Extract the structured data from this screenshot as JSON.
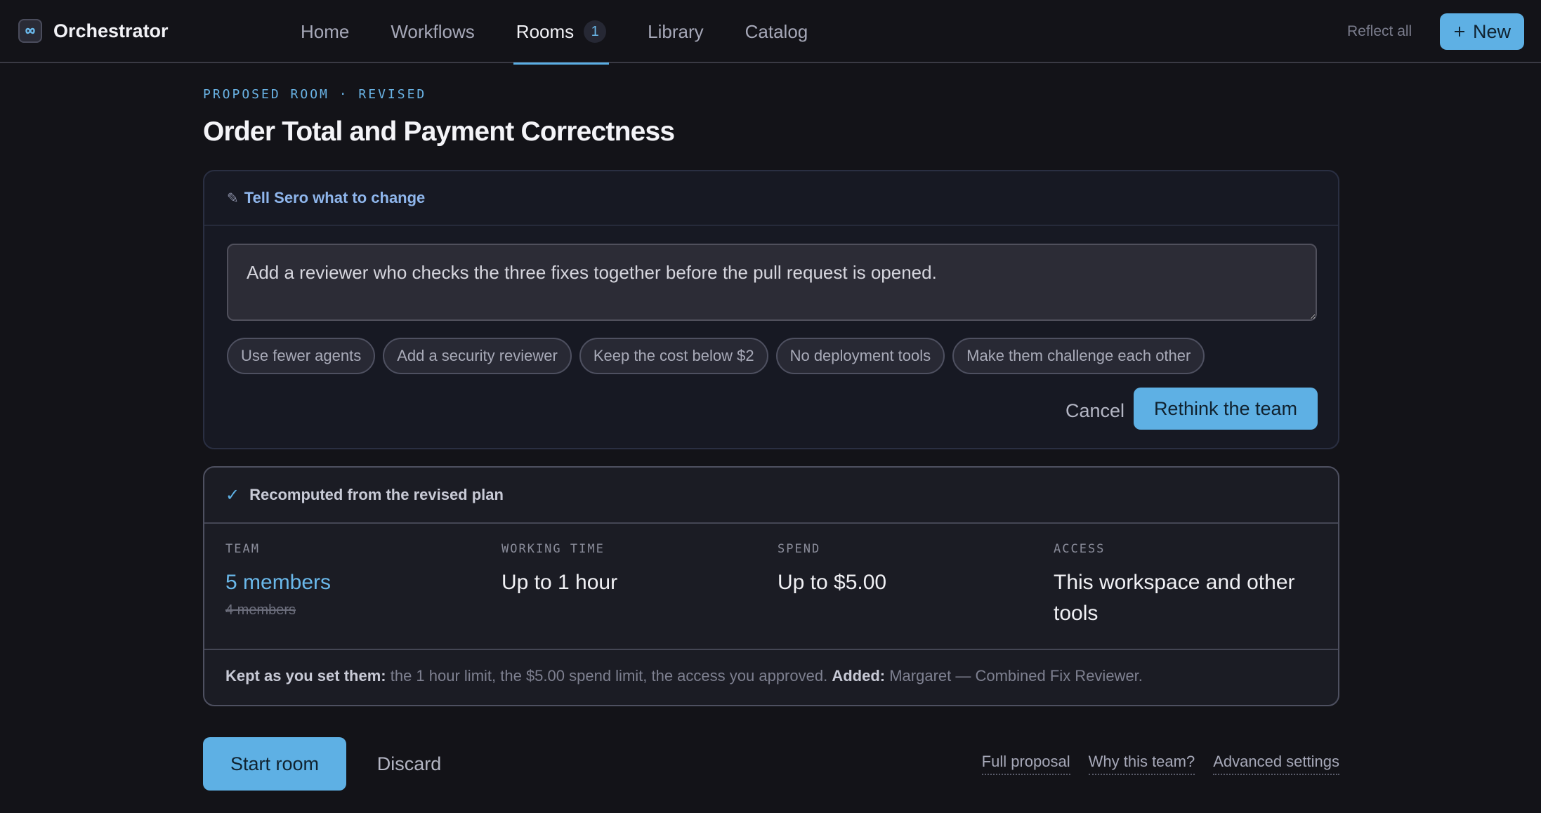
{
  "app": {
    "name": "Orchestrator",
    "logo_icon": "infinity-logo-icon"
  },
  "nav": {
    "items": [
      {
        "label": "Home"
      },
      {
        "label": "Workflows"
      },
      {
        "label": "Rooms",
        "badge": "1",
        "active": true
      },
      {
        "label": "Library"
      },
      {
        "label": "Catalog"
      }
    ],
    "reflect_all": "Reflect all",
    "new_label": "New",
    "new_icon": "plus-icon"
  },
  "header": {
    "eyebrow": "PROPOSED ROOM · REVISED",
    "title": "Order Total and Payment Correctness"
  },
  "edit": {
    "heading": "Tell Sero what to change",
    "heading_icon": "pencil-icon",
    "prompt_value": "Add a reviewer who checks the three fixes together before the pull request is opened.",
    "chips": [
      "Use fewer agents",
      "Add a security reviewer",
      "Keep the cost below $2",
      "No deployment tools",
      "Make them challenge each other"
    ],
    "cancel_label": "Cancel",
    "rethink_label": "Rethink the team"
  },
  "summary": {
    "heading": "Recomputed from the revised plan",
    "heading_icon": "check-icon",
    "stats": [
      {
        "label": "TEAM",
        "value": "5 members",
        "previous": "4 members"
      },
      {
        "label": "WORKING TIME",
        "value": "Up to 1 hour"
      },
      {
        "label": "SPEND",
        "value": "Up to $5.00"
      },
      {
        "label": "ACCESS",
        "value": "This workspace and other tools"
      }
    ],
    "kept_label": "Kept as you set them:",
    "kept_text": "the 1 hour limit, the $5.00 spend limit, the access you approved.",
    "added_label": "Added:",
    "added_text": "Margaret — Combined Fix Reviewer."
  },
  "actions": {
    "start_label": "Start room",
    "discard_label": "Discard",
    "links": [
      "Full proposal",
      "Why this team?",
      "Advanced settings"
    ]
  },
  "colors": {
    "accent": "#5eb0e4",
    "background": "#131318"
  }
}
